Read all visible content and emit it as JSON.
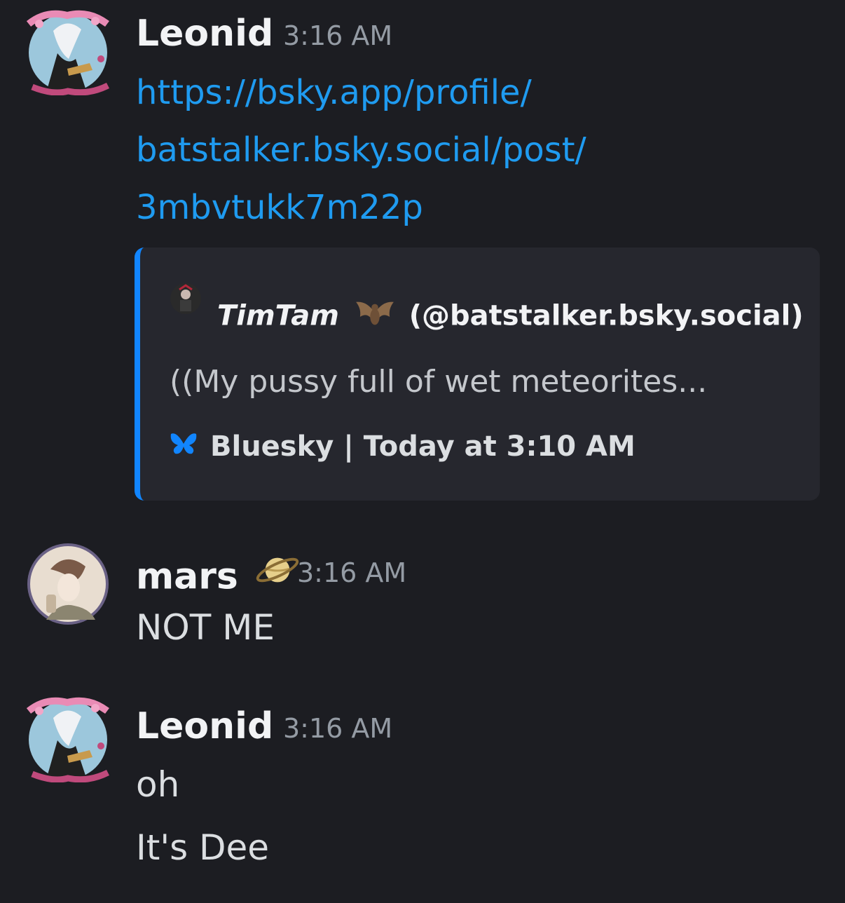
{
  "colors": {
    "background": "#1c1d22",
    "embed_background": "#26272e",
    "embed_accent": "#1185fe",
    "link": "#1f9bf0",
    "timestamp": "#949ba4"
  },
  "messages": [
    {
      "username": "Leonid",
      "timestamp": "3:16 AM",
      "avatar_icon": "leonid-avatar",
      "link_lines": [
        "https://bsky.app/profile/",
        "batstalker.bsky.social/post/",
        "3mbvtukk7m22p"
      ],
      "embed": {
        "author_name": "TimTam",
        "author_emoji_icon": "bat-icon",
        "author_handle": "(@batstalker.bsky.social)",
        "description": "((My pussy full of wet meteorites...",
        "provider_icon": "butterfly-icon",
        "footer": "Bluesky | Today at 3:10 AM"
      }
    },
    {
      "username": "mars",
      "username_emoji_icon": "saturn-icon",
      "timestamp": "3:16 AM",
      "avatar_icon": "mars-avatar",
      "lines": [
        "NOT ME"
      ]
    },
    {
      "username": "Leonid",
      "timestamp": "3:16 AM",
      "avatar_icon": "leonid-avatar",
      "lines": [
        "oh",
        "It's Dee"
      ]
    }
  ]
}
